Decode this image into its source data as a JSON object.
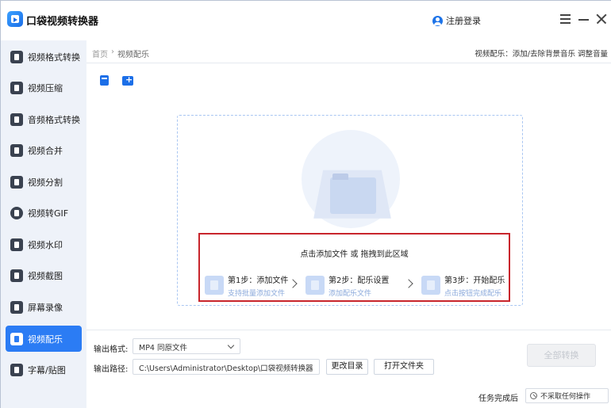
{
  "app": {
    "title": "口袋视频转换器",
    "login_label": "注册登录"
  },
  "sidebar": {
    "items": [
      {
        "label": "视频格式转换",
        "active": false
      },
      {
        "label": "视频压缩",
        "active": false
      },
      {
        "label": "音频格式转换",
        "active": false
      },
      {
        "label": "视频合并",
        "active": false
      },
      {
        "label": "视频分割",
        "active": false
      },
      {
        "label": "视频转GIF",
        "active": false
      },
      {
        "label": "视频水印",
        "active": false
      },
      {
        "label": "视频截图",
        "active": false
      },
      {
        "label": "屏幕录像",
        "active": false
      },
      {
        "label": "视频配乐",
        "active": true
      },
      {
        "label": "字幕/贴图",
        "active": false
      }
    ]
  },
  "breadcrumb": {
    "home": "首页",
    "separator": "›",
    "current": "视频配乐"
  },
  "tip": "视频配乐：添加/去除背景音乐 调整音量",
  "dropzone": {
    "headline": "点击添加文件 或 拖拽到此区域",
    "steps": [
      {
        "title": "第1步：添加文件",
        "desc": "支持批量添加文件"
      },
      {
        "title": "第2步：配乐设置",
        "desc": "添加配乐文件"
      },
      {
        "title": "第3步：开始配乐",
        "desc": "点击按钮完成配乐"
      }
    ]
  },
  "output": {
    "format_label": "输出格式:",
    "format_value": "MP4  同原文件",
    "path_label": "输出路径:",
    "path_value": "C:\\Users\\Administrator\\Desktop\\口袋视频转换器",
    "change_dir_button": "更改目录",
    "open_folder_button": "打开文件夹",
    "convert_all_button": "全部转换"
  },
  "footer": {
    "after_task_label": "任务完成后",
    "after_task_value": "不采取任何操作"
  },
  "colors": {
    "accent": "#2b7cf4",
    "sidebar_bg": "#eef2f9",
    "highlight_border": "#c8252c"
  }
}
